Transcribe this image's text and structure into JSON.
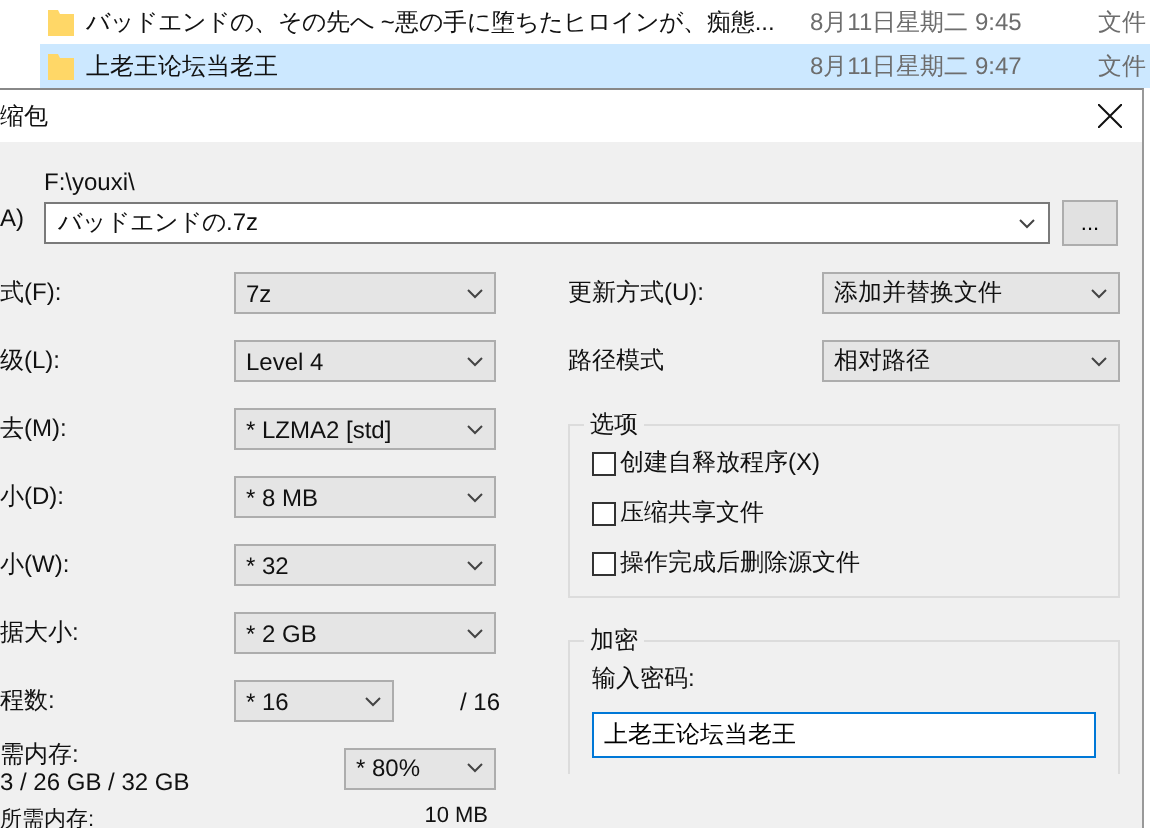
{
  "file_list": [
    {
      "name": "バッドエンドの、その先へ ~悪の手に堕ちたヒロインが、痴態...",
      "date": "8月11日星期二 9:45",
      "type": "文件",
      "selected": false
    },
    {
      "name": "上老王论坛当老王",
      "date": "8月11日星期二 9:47",
      "type": "文件",
      "selected": true
    }
  ],
  "dialog": {
    "title": "缩包",
    "archive": {
      "label": "A)",
      "folder": "F:\\youxi\\",
      "value": "バッドエンドの.7z",
      "browse": "..."
    },
    "left_fields": [
      {
        "kind": "combo",
        "label": "式(F):",
        "value": "7z"
      },
      {
        "kind": "combo",
        "label": "级(L):",
        "value": "Level 4"
      },
      {
        "kind": "combo",
        "label": "去(M):",
        "value": "* LZMA2 [std]"
      },
      {
        "kind": "combo",
        "label": "小(D):",
        "value": "* 8 MB"
      },
      {
        "kind": "combo",
        "label": "小(W):",
        "value": "* 32"
      },
      {
        "kind": "combo",
        "label": "据大小:",
        "value": "* 2 GB"
      },
      {
        "kind": "short",
        "label": "程数:",
        "value": "* 16",
        "suffix": "/ 16"
      }
    ],
    "memory": {
      "label": "需内存:",
      "detail": "3 / 26 GB / 32 GB",
      "value": "* 80%"
    },
    "bottom": {
      "label": "所需内存:",
      "value": "10 MB"
    },
    "right_fields": [
      {
        "label": "更新方式(U):",
        "value": "添加并替换文件"
      },
      {
        "label": "路径模式",
        "value": "相对路径"
      }
    ],
    "options": {
      "title": "选项",
      "checkboxes": [
        {
          "label": "创建自释放程序(X)",
          "checked": false
        },
        {
          "label": "压缩共享文件",
          "checked": false
        },
        {
          "label": "操作完成后删除源文件",
          "checked": false
        }
      ]
    },
    "encryption": {
      "title": "加密",
      "label": "输入密码:",
      "value": "上老王论坛当老王"
    }
  }
}
